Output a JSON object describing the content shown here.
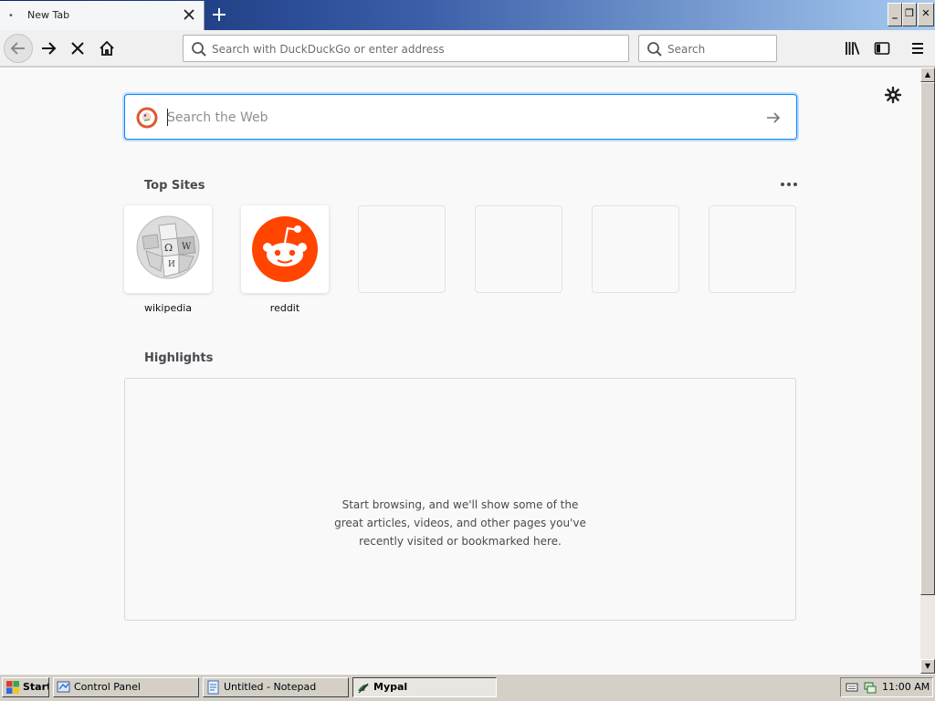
{
  "browser": {
    "tab": {
      "title": "New Tab",
      "dot": "•"
    },
    "window_buttons": [
      "_",
      "❐",
      "✕"
    ],
    "urlbar": {
      "placeholder": "Search with DuckDuckGo or enter address",
      "value": ""
    },
    "searchbar": {
      "placeholder": "Search",
      "value": ""
    }
  },
  "newtab": {
    "websearch": {
      "placeholder": "Search the Web",
      "value": ""
    },
    "top_sites": {
      "title": "Top Sites",
      "tiles": [
        {
          "label": "wikipedia",
          "icon": "wikipedia-globe-icon"
        },
        {
          "label": "reddit",
          "icon": "reddit-alien-icon"
        },
        {
          "label": ""
        },
        {
          "label": ""
        },
        {
          "label": ""
        },
        {
          "label": ""
        }
      ]
    },
    "highlights": {
      "title": "Highlights",
      "empty_message": "Start browsing, and we'll show some of the great articles, videos, and other pages you've recently visited or bookmarked here."
    }
  },
  "taskbar": {
    "start_label": "Start",
    "buttons": [
      {
        "label": "Control Panel",
        "icon": "control-panel-icon"
      },
      {
        "label": "Untitled - Notepad",
        "icon": "notepad-icon"
      },
      {
        "label": "Mypal",
        "icon": "mypal-icon",
        "active": true
      }
    ],
    "clock": "11:00 AM"
  },
  "colors": {
    "accent": "#0a84ff",
    "reddit": "#ff4500",
    "titlebar": "#0a246a"
  }
}
